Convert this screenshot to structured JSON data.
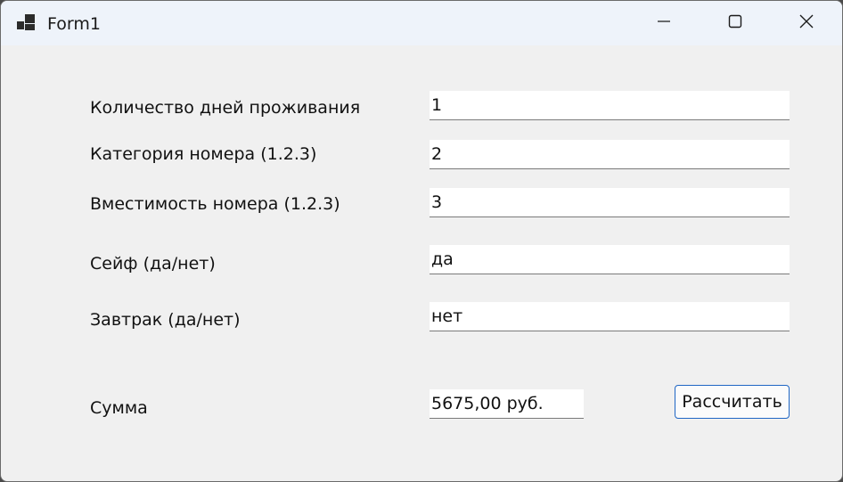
{
  "window": {
    "title": "Form1",
    "icon": "app-form-icon",
    "controls": {
      "minimize_icon": "minimize-icon",
      "maximize_icon": "maximize-icon",
      "close_icon": "close-icon"
    }
  },
  "form": {
    "fields": [
      {
        "label": "Количество дней проживания",
        "value": "1"
      },
      {
        "label": "Категория номера (1.2.3)",
        "value": "2"
      },
      {
        "label": "Вместимость номера (1.2.3)",
        "value": "3"
      },
      {
        "label": "Сейф (да/нет)",
        "value": "да"
      },
      {
        "label": "Завтрак (да/нет)",
        "value": "нет"
      }
    ],
    "sum": {
      "label": "Сумма",
      "value": "5675,00 руб."
    },
    "calculate_button": "Рассчитать"
  },
  "colors": {
    "titlebar": "#eef3fa",
    "form_background": "#f0f0f0",
    "button_border": "#1f66c4"
  }
}
